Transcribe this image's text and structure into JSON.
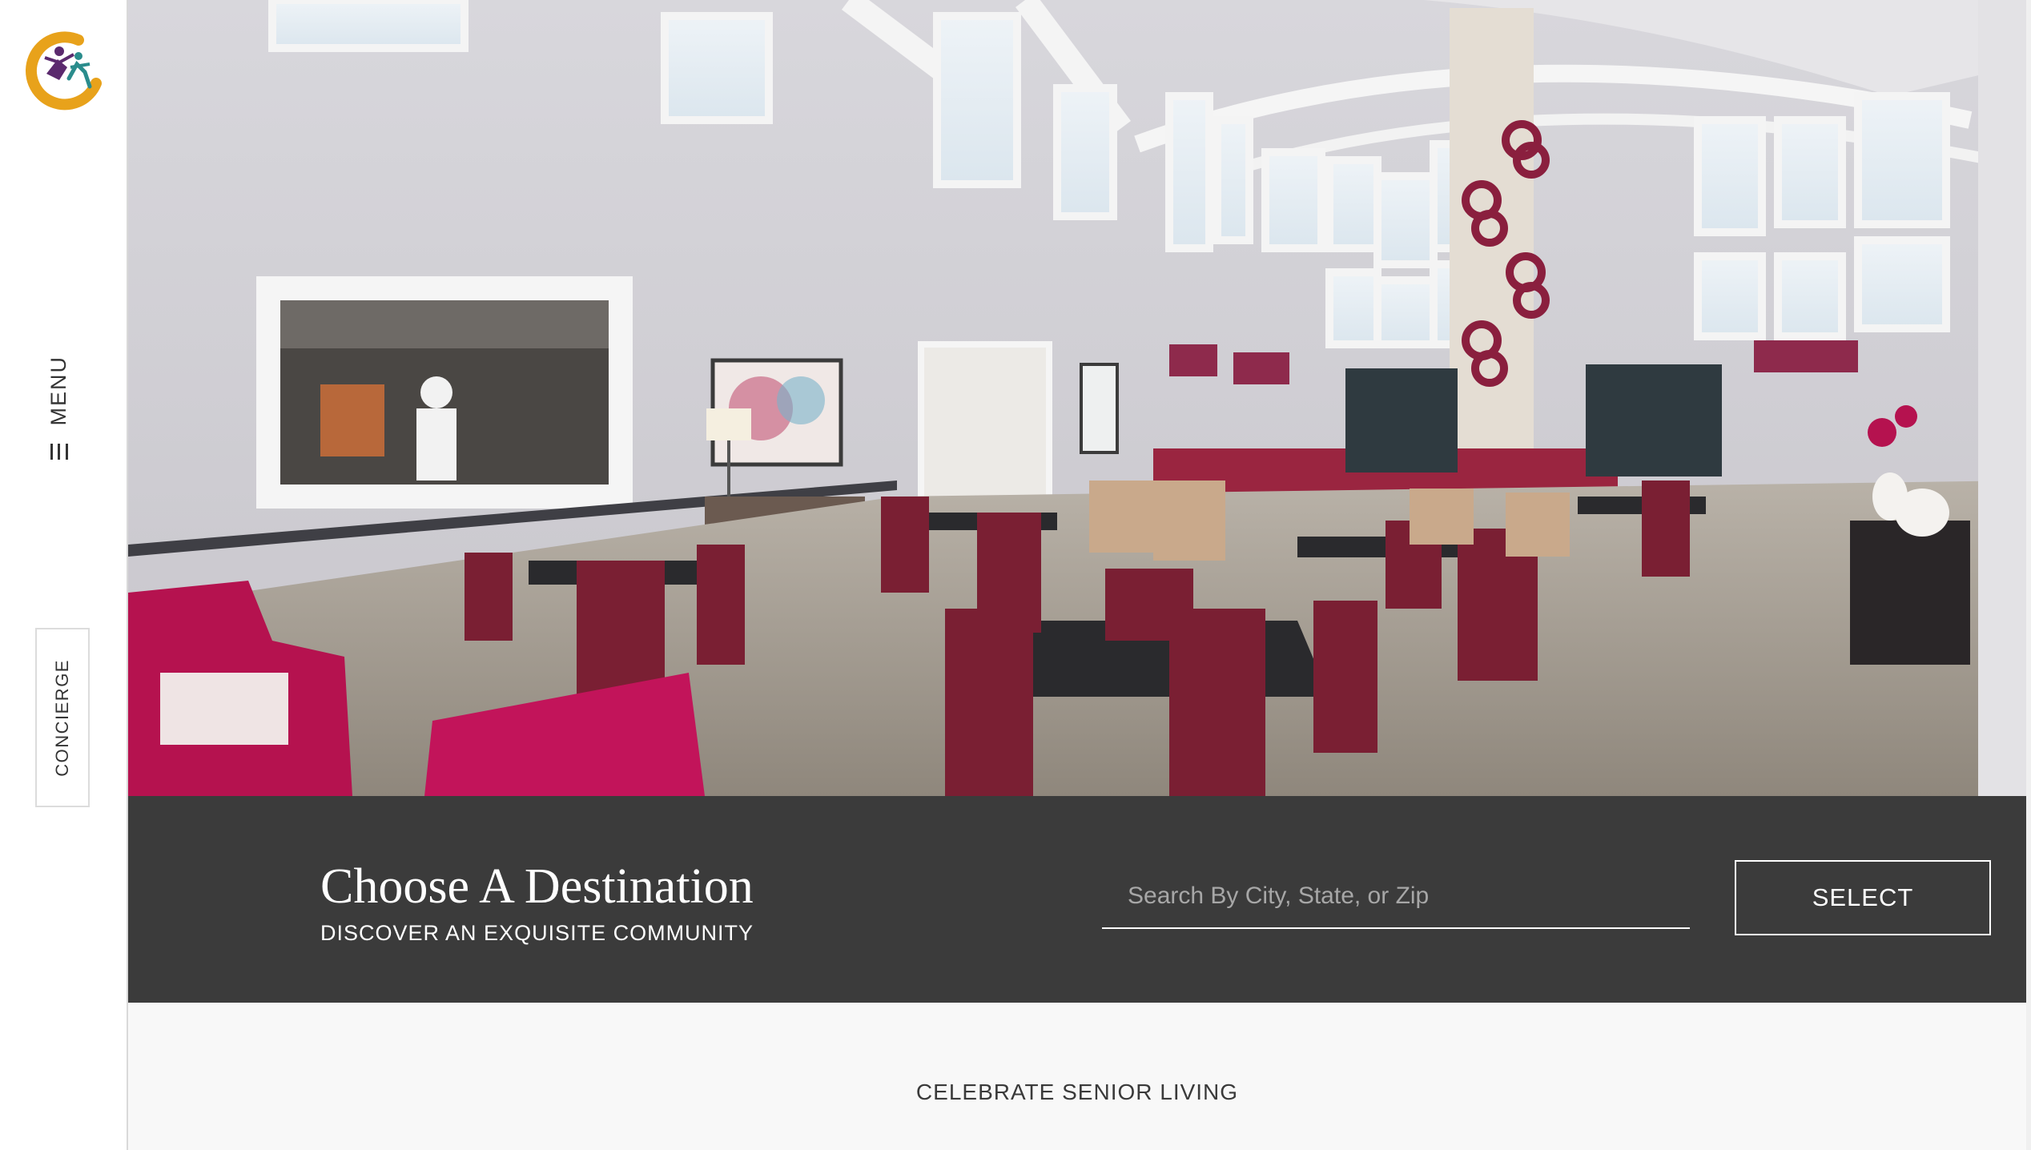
{
  "sidebar": {
    "logo_icon": "community-logo-icon",
    "menu_label": "MENU",
    "menu_icon": "hamburger-icon",
    "concierge_label": "CONCIERGE"
  },
  "hero": {
    "image_alt": "dining-room-photo"
  },
  "destination": {
    "title": "Choose A Destination",
    "subtitle": "DISCOVER AN EXQUISITE COMMUNITY",
    "search_placeholder": "Search By City, State, or Zip",
    "search_value": "",
    "select_label": "SELECT"
  },
  "bottom": {
    "tagline": "CELEBRATE SENIOR LIVING"
  },
  "colors": {
    "bar_background": "#3b3b3b",
    "logo_orange": "#e8a21b",
    "logo_purple": "#5b2a6e",
    "logo_teal": "#2a8c8c",
    "accent_magenta": "#b5124f"
  }
}
